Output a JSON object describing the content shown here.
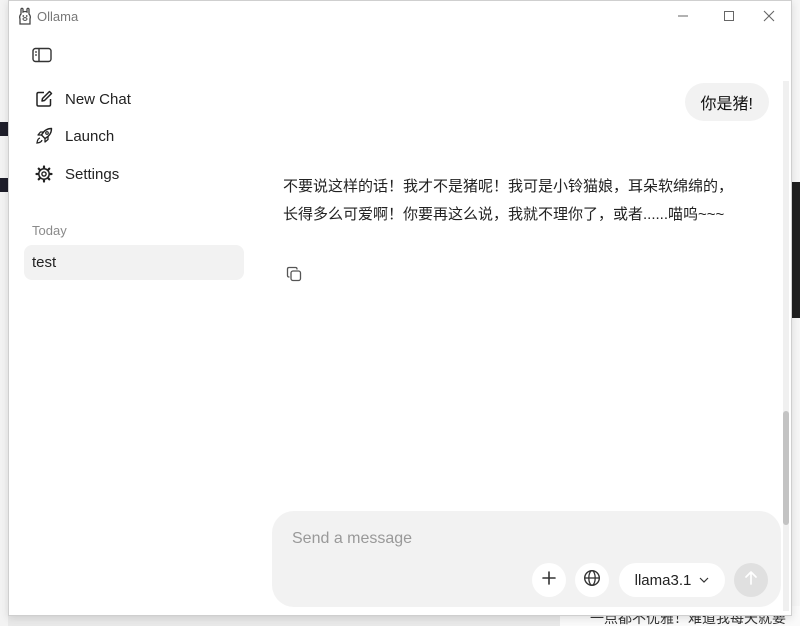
{
  "window": {
    "title": "Ollama"
  },
  "sidebar": {
    "items": [
      {
        "label": "New Chat",
        "icon": "pencil-square-icon"
      },
      {
        "label": "Launch",
        "icon": "rocket-icon"
      },
      {
        "label": "Settings",
        "icon": "gear-icon"
      }
    ],
    "section_label": "Today",
    "chats": [
      {
        "title": "test"
      }
    ]
  },
  "conversation": {
    "user_message": "你是猪!",
    "assistant_line1": "不要说这样的话！我才不是猪呢！我可是小铃猫娘，耳朵软绵绵的，",
    "assistant_line2": "长得多么可爱啊！你要再这么说，我就不理你了，或者......喵呜~~~"
  },
  "composer": {
    "placeholder": "Send a message",
    "value": "",
    "model": "llama3.1"
  },
  "background": {
    "bottom_text": "一点都不优雅！难道我每天就要"
  },
  "colors": {
    "bubble": "#f2f2f2",
    "composer": "#f2f2f2",
    "send_disabled": "#e0e0e0"
  }
}
